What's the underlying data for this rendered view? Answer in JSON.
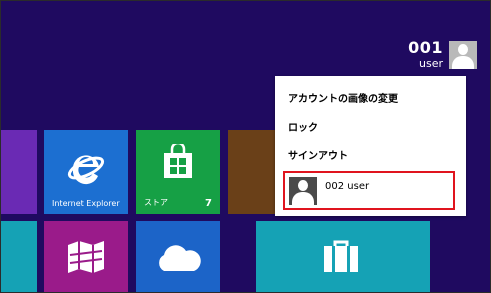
{
  "user": {
    "name": "001",
    "subtitle": "user"
  },
  "tiles": {
    "ie": {
      "label": "Internet Explorer",
      "color": "#1c6fd1"
    },
    "store": {
      "label": "ストア",
      "badge": "7",
      "color": "#16a045"
    },
    "maps": {
      "color": "#9a1b8a"
    },
    "skydrive": {
      "color": "#1c64c8"
    },
    "briefcase": {
      "color": "#15a2b5"
    }
  },
  "account_menu": {
    "items": [
      "アカウントの画像の変更",
      "ロック",
      "サインアウト"
    ],
    "switch_user": "002 user"
  }
}
